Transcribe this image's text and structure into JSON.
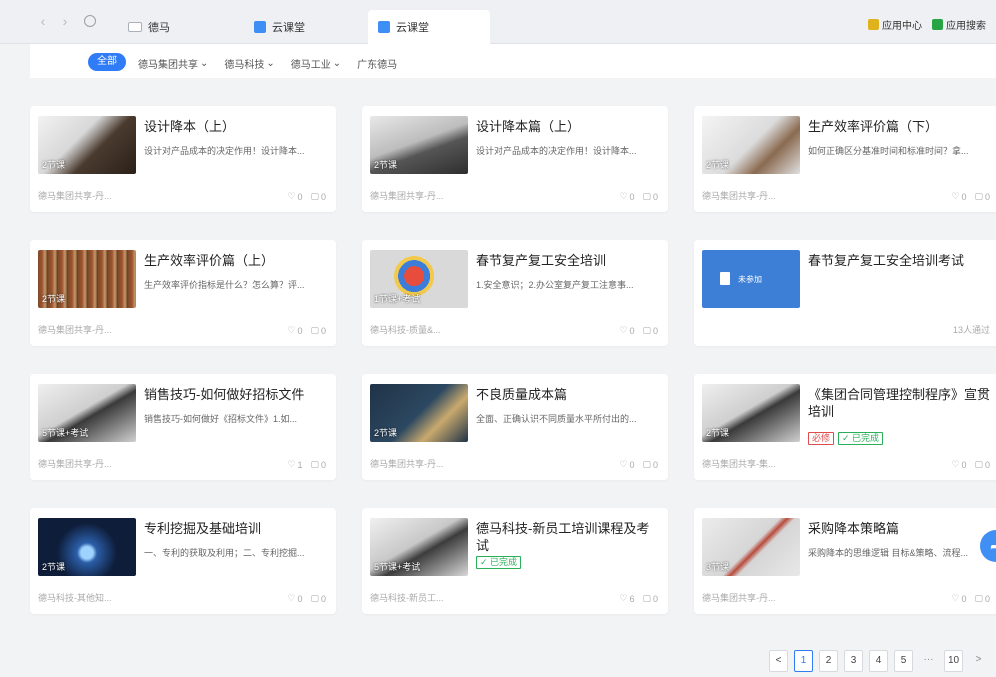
{
  "browser": {
    "tabs": [
      {
        "label": "德马"
      },
      {
        "label": "云课堂"
      },
      {
        "label": "云课堂"
      }
    ],
    "links": [
      {
        "label": "应用中心",
        "color": "#e0b21d"
      },
      {
        "label": "应用搜索",
        "color": "#27a545"
      }
    ]
  },
  "filters": {
    "all": "全部",
    "items": [
      "德马集团共享",
      "德马科技",
      "德马工业",
      "广东德马"
    ]
  },
  "cards": [
    {
      "title": "设计降本（上）",
      "desc": "设计对产品成本的决定作用！设计降本...",
      "tag": "2节课",
      "source": "德马集团共享-丹...",
      "likes": "0",
      "comments": "0"
    },
    {
      "title": "设计降本篇（上）",
      "desc": "设计对产品成本的决定作用！设计降本...",
      "tag": "2节课",
      "source": "德马集团共享-丹...",
      "likes": "0",
      "comments": "0"
    },
    {
      "title": "生产效率评价篇（下）",
      "desc": "如何正确区分基准时间和标准时间？拿...",
      "tag": "2节课",
      "source": "德马集团共享-丹...",
      "likes": "0",
      "comments": "0"
    },
    {
      "title": "生产效率评价篇（上）",
      "desc": "生产效率评价指标是什么？怎么算？评...",
      "tag": "2节课",
      "source": "德马集团共享-丹...",
      "likes": "0",
      "comments": "0"
    },
    {
      "title": "春节复产复工安全培训",
      "desc": "1.安全意识；2.办公室复产复工注意事...",
      "tag": "1节课+考试",
      "source": "德马科技-质量&...",
      "likes": "0",
      "comments": "0"
    },
    {
      "title": "春节复产复工安全培训考试",
      "desc": "",
      "tag": "",
      "thumb_text": "未参加",
      "source": "",
      "passed": "13人通过"
    },
    {
      "title": "销售技巧-如何做好招标文件",
      "desc": "销售技巧-如何做好《招标文件》1.如...",
      "tag": "5节课+考试",
      "source": "德马集团共享-丹...",
      "likes": "1",
      "comments": "0"
    },
    {
      "title": "不良质量成本篇",
      "desc": "全面、正确认识不同质量水平所付出的...",
      "tag": "2节课",
      "source": "德马集团共享-丹...",
      "likes": "0",
      "comments": "0"
    },
    {
      "title": "《集团合同管理控制程序》宣贯培训",
      "desc": "",
      "tag": "2节课",
      "source": "德马集团共享-集...",
      "likes": "0",
      "comments": "0",
      "badge_required": "必修",
      "badge_done": "✓ 已完成"
    },
    {
      "title": "专利挖掘及基础培训",
      "desc": "一、专利的获取及利用；二、专利挖掘...",
      "tag": "2节课",
      "source": "德马科技-其他知...",
      "likes": "0",
      "comments": "0"
    },
    {
      "title": "德马科技-新员工培训课程及考试",
      "desc": "",
      "tag": "5节课+考试",
      "source": "德马科技-新员工...",
      "likes": "6",
      "comments": "0",
      "badge_done": "✓ 已完成"
    },
    {
      "title": "采购降本策略篇",
      "desc": "采购降本的思维逻辑 目标&策略、流程...",
      "tag": "3节课",
      "source": "德马集团共享-丹...",
      "likes": "0",
      "comments": "0"
    }
  ],
  "pagination": {
    "prev": "<",
    "pages": [
      "1",
      "2",
      "3",
      "4",
      "5"
    ],
    "ellipsis": "···",
    "last": "10",
    "next": ">"
  },
  "colors": {
    "accent": "#2f7cf6",
    "required": "#e24b4b",
    "done": "#2bb05a"
  }
}
